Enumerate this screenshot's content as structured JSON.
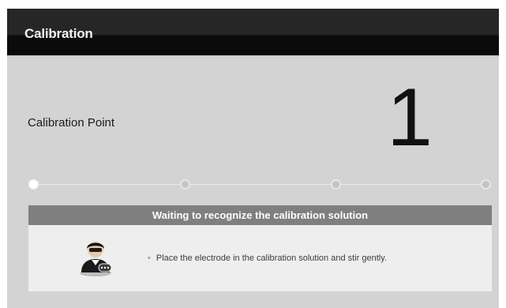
{
  "header": {
    "title": "Calibration"
  },
  "calibration": {
    "label": "Calibration Point",
    "point_number": "1",
    "steps_total": 4,
    "active_step": 1
  },
  "panel": {
    "status": "Waiting to recognize the calibration solution",
    "instruction_bullet": "•",
    "instruction": "Place the electrode in the calibration solution and stir gently."
  },
  "icons": {
    "operator": "operator-avatar-icon"
  },
  "colors": {
    "title_bar": "#0c0c0c",
    "background": "#d3d3d3",
    "panel_header": "#7f7f7f",
    "panel_body": "#eeeeee"
  }
}
